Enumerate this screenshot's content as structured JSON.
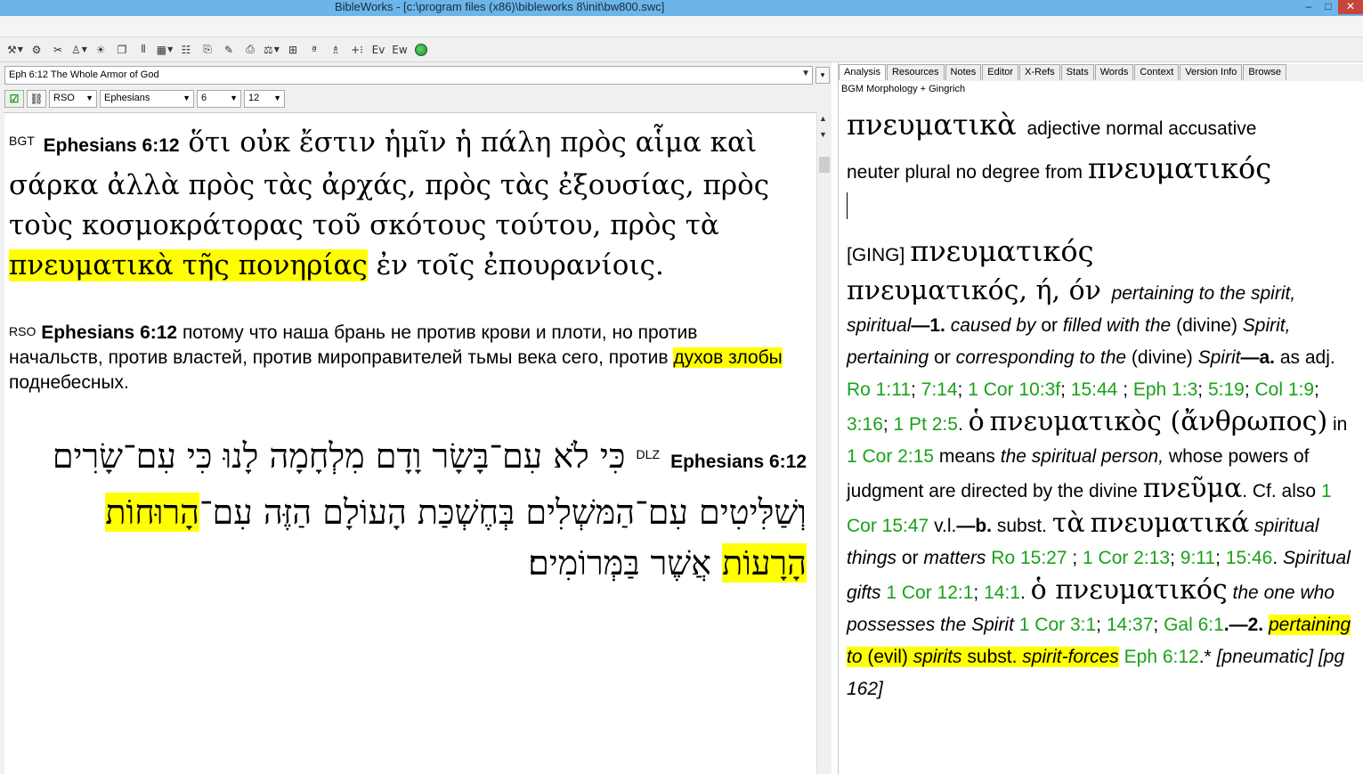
{
  "window": {
    "title": "BibleWorks - [c:\\program files (x86)\\bibleworks 8\\init\\bw800.swc]"
  },
  "toolbar": {
    "icons": [
      "search-tools",
      "gear",
      "pin",
      "person",
      "lamp",
      "windows",
      "bars",
      "grid",
      "list",
      "copy",
      "folder",
      "print",
      "scale",
      "frame",
      "pen",
      "stamp",
      "plus",
      "ev",
      "ew",
      "globe"
    ]
  },
  "left": {
    "reference": "Eph 6:12 The Whole Armor of God",
    "version_select": "RSO",
    "book_select": "Ephesians",
    "chapter_select": "6",
    "verse_select": "12",
    "greek": {
      "version": "BGT",
      "ref": "Ephesians 6:12",
      "text_before": "ὅτι οὐκ ἔστιν ἡμῖν ἡ πάλη πρὸς αἷμα καὶ σάρκα ἀλλὰ πρὸς τὰς ἀρχάς, πρὸς τὰς ἐξουσίας, πρὸς τοὺς κοσμοκράτορας τοῦ σκότους τούτου, πρὸς τὰ",
      "highlight": "πνευματικὰ τῆς πονηρίας",
      "text_after": "ἐν τοῖς ἐπουρανίοις."
    },
    "russian": {
      "version": "RSO",
      "ref": "Ephesians 6:12",
      "text_before": "потому что наша брань не против крови и плоти, но против начальств, против властей, против мироправителей тьмы века сего, против",
      "highlight": "духов злобы",
      "text_after": "поднебесных."
    },
    "hebrew": {
      "version": "DLZ",
      "ref": "Ephesians 6:12",
      "text_before": "כִּי לֹא עִם־בָּשָׂר וָדָם מִלְחָמָה לָנוּ כִּי עִם־שָׂרִים וְשַׁלִּיטִים עִם־הַמּשְׁלִים בְּחֶשְׁכַּת הָעוֹלָם הַזֶּה עִם־",
      "highlight": "הָרוּחוֹת הָרָעוֹת",
      "text_after": "אֲשֶׁר בַּמְּרוֹמִים׃"
    }
  },
  "right": {
    "tabs": [
      "Analysis",
      "Resources",
      "Notes",
      "Editor",
      "X-Refs",
      "Stats",
      "Words",
      "Context",
      "Version Info",
      "Browse"
    ],
    "subtitle": "BGM Morphology + Gingrich",
    "lemma_word": "πνευματικὰ",
    "parse_1": "adjective normal accusative",
    "parse_2": "neuter plural no degree from",
    "lemma": "πνευματικός",
    "ging_tag": "[GING]",
    "ging_lemma": "πνευματικός",
    "entry_head": "πνευματικός",
    "entry_forms": ", ή, όν",
    "def_1": "pertaining to the spirit, spiritual",
    "dash_1": "—1.",
    "def_caused": "caused by",
    "or_1": "or",
    "def_filled": "filled with the",
    "divine_1": "(divine)",
    "def_spirit_pert": "Spirit, pertaining",
    "or_2": "or",
    "def_corr": "corresponding to the",
    "divine_2": "(divine)",
    "def_spirit_2": "Spirit",
    "dash_a": "—a.",
    "as_adj": "as adj.",
    "refs_a": [
      "Ro 1:11",
      "7:14",
      "1 Cor 10:3f",
      "15:44",
      "Eph 1:3",
      "5:19",
      "Col 1:9",
      "3:16",
      "1 Pt 2:5"
    ],
    "greek_ho": "ὁ",
    "greek_phrase": "πνευματικὸς (ἄνθρωπος)",
    "in_word": "in",
    "ref_1cor215": "1 Cor 2:15",
    "means": "means",
    "means_it": "the spiritual person,",
    "means_rest": "whose powers of judgment are directed by the divine",
    "pneuma": "πνεῦμα",
    "cf": ". Cf. also",
    "ref_1cor1547": "1 Cor 15:47",
    "vl": "v.l.",
    "dash_b": "—b.",
    "subst": "subst.",
    "ta": "τὰ",
    "pneumatika": "πνευματικά",
    "spir_things": "spiritual things",
    "or_3": "or",
    "matters": "matters",
    "refs_b": [
      "Ro 15:27",
      "1 Cor 2:13",
      "9:11",
      "15:46"
    ],
    "spir_gifts": "Spiritual gifts",
    "refs_c": [
      "1 Cor 12:1",
      "14:1"
    ],
    "ho_pneumatikos": "ὁ πνευματικός",
    "one_who": "the one who possesses the Spirit",
    "refs_d": [
      "1 Cor 3:1",
      "14:37",
      "Gal 6:1"
    ],
    "dash_2": ".—2.",
    "hl_pert": "pertaining to",
    "hl_evil": "(evil)",
    "hl_spirits": "spirits",
    "hl_subst": "subst.",
    "hl_forces": "spirit-forces",
    "ref_eph612": "Eph 6:12",
    "star": ".*",
    "pneumatic": "[pneumatic] [pg 162]"
  }
}
